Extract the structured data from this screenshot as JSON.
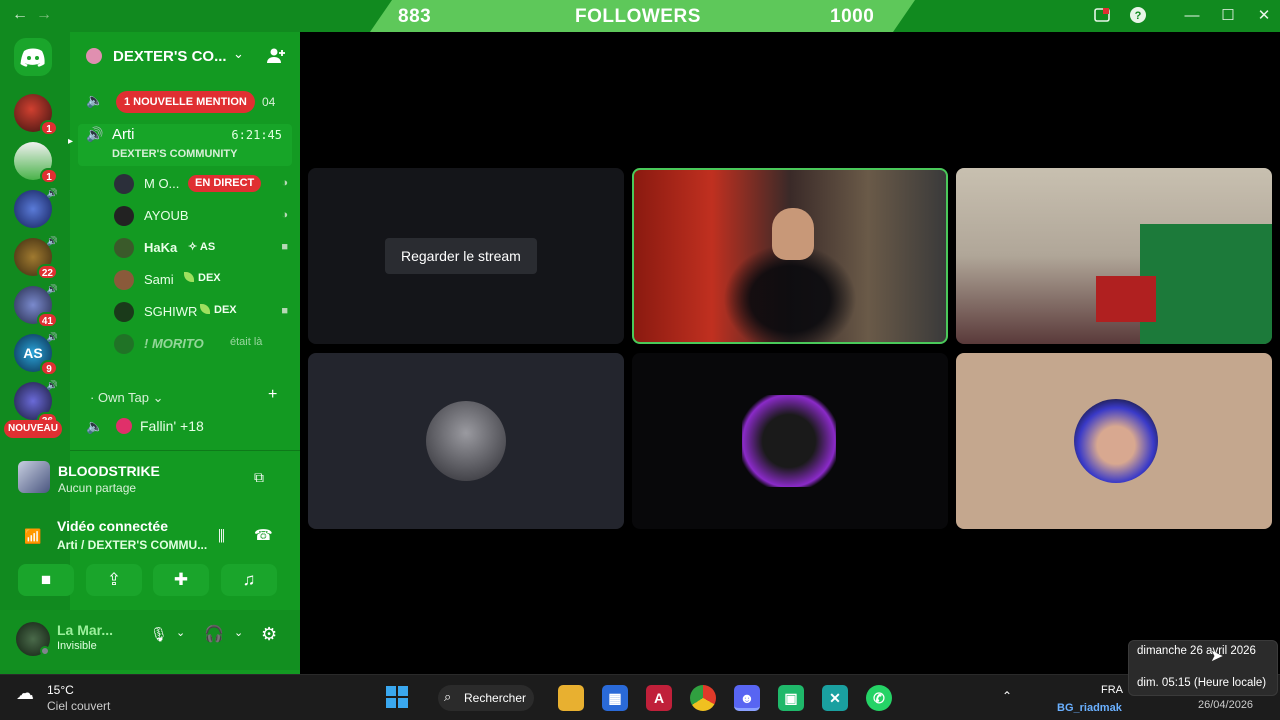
{
  "titlebar": {
    "back_icon": "arrow-left-icon",
    "forward_icon": "arrow-right-icon",
    "followers_current": "883",
    "followers_label": "FOLLOWERS",
    "followers_goal": "1000"
  },
  "rail": {
    "badges": [
      "1",
      "1",
      "22",
      "41",
      "9",
      "36"
    ],
    "new_label": "NOUVEAU"
  },
  "server": {
    "name": "DEXTER'S CO...",
    "mention_banner": "1 NOUVELLE MENTION",
    "mention_count": "04"
  },
  "channel": {
    "name": "Arti",
    "timer": "6:21:45",
    "subtitle": "DEXTER'S COMMUNITY",
    "users": [
      {
        "name": "M O...",
        "tag": "EN DIRECT"
      },
      {
        "name": "AYOUB",
        "tag": ""
      },
      {
        "name": "HaKa",
        "tag": "AS"
      },
      {
        "name": "Sami",
        "tag": "DEX"
      },
      {
        "name": "SGHIWR",
        "tag": "DEX"
      },
      {
        "name": "! MORITO",
        "tag": "était là"
      }
    ]
  },
  "category": {
    "name": "Own Tap",
    "channel2": "Fallin' +18"
  },
  "activity": {
    "game": "BLOODSTRIKE",
    "status": "Aucun partage"
  },
  "voice": {
    "status": "Vidéo connectée",
    "location": "Arti / DEXTER'S COMMU..."
  },
  "user": {
    "name": "La Mar...",
    "status": "Invisible"
  },
  "stage": {
    "watch_button": "Regarder le stream"
  },
  "taskbar": {
    "temperature": "15°C",
    "weather": "Ciel couvert",
    "search": "Rechercher",
    "lang": "FRA",
    "username": "BG_riadmak",
    "date": "26/04/2026"
  },
  "tooltip": {
    "line1": "dimanche 26 avril 2026",
    "line2": "dim. 05:15 (Heure locale)"
  },
  "colors": {
    "accent_green": "#118a1f",
    "sidebar_green": "#139a22",
    "followers_bar": "#5ec85a",
    "alert_red": "#e02f32"
  }
}
